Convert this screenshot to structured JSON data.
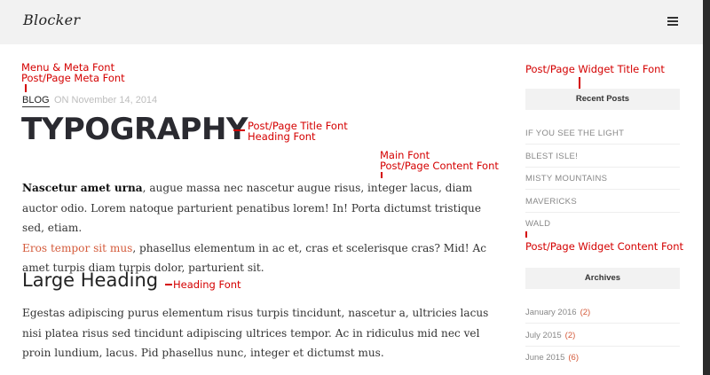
{
  "header": {
    "logo": "Blocker",
    "menu_icon": "hamburger-menu-icon"
  },
  "annotations": {
    "menu_meta_line1": "Menu & Meta Font",
    "menu_meta_line2": "Post/Page Meta Font",
    "title_line1": "Post/Page Title Font",
    "title_line2": "Heading Font",
    "main_line1": "Main Font",
    "main_line2": "Post/Page Content Font",
    "heading_font": "Heading Font",
    "widget_title_font": "Post/Page Widget Title Font",
    "widget_content_font": "Post/Page Widget Content Font"
  },
  "post": {
    "category": "BLOG",
    "date": "ON November 14, 2014",
    "title": "TYPOGRAPHY",
    "p1_bold": "Nascetur amet urna",
    "p1_rest": ", augue massa nec nascetur augue risus, integer lacus, diam auctor odio. Lorem natoque parturient penatibus lorem! In! Porta dictumst tristique sed, etiam.",
    "p1_link": "Eros tempor sit mus",
    "p1_end": ", phasellus elementum in ac et, cras et scelerisque cras? Mid! Ac amet turpis diam turpis dolor, parturient sit.",
    "heading": "Large Heading",
    "p2": "Egestas adipiscing purus elementum risus turpis tincidunt, nascetur a, ultricies lacus nisi platea risus sed tincidunt adipiscing ultrices tempor. Ac in ridiculus mid nec vel proin lundium, lacus. Pid phasellus nunc, integer et dictumst mus."
  },
  "sidebar": {
    "recent_title": "Recent Posts",
    "recent": [
      "IF YOU SEE THE LIGHT",
      "BLEST ISLE!",
      "MISTY MOUNTAINS",
      "MAVERICKS",
      "WALD"
    ],
    "archives_title": "Archives",
    "archives": [
      {
        "label": "January 2016",
        "count": "(2)"
      },
      {
        "label": "July 2015",
        "count": "(2)"
      },
      {
        "label": "June 2015",
        "count": "(6)"
      }
    ]
  },
  "colors": {
    "accent": "#d45a3a",
    "annotation": "#d40000",
    "header_bg": "#f2f2f2"
  }
}
